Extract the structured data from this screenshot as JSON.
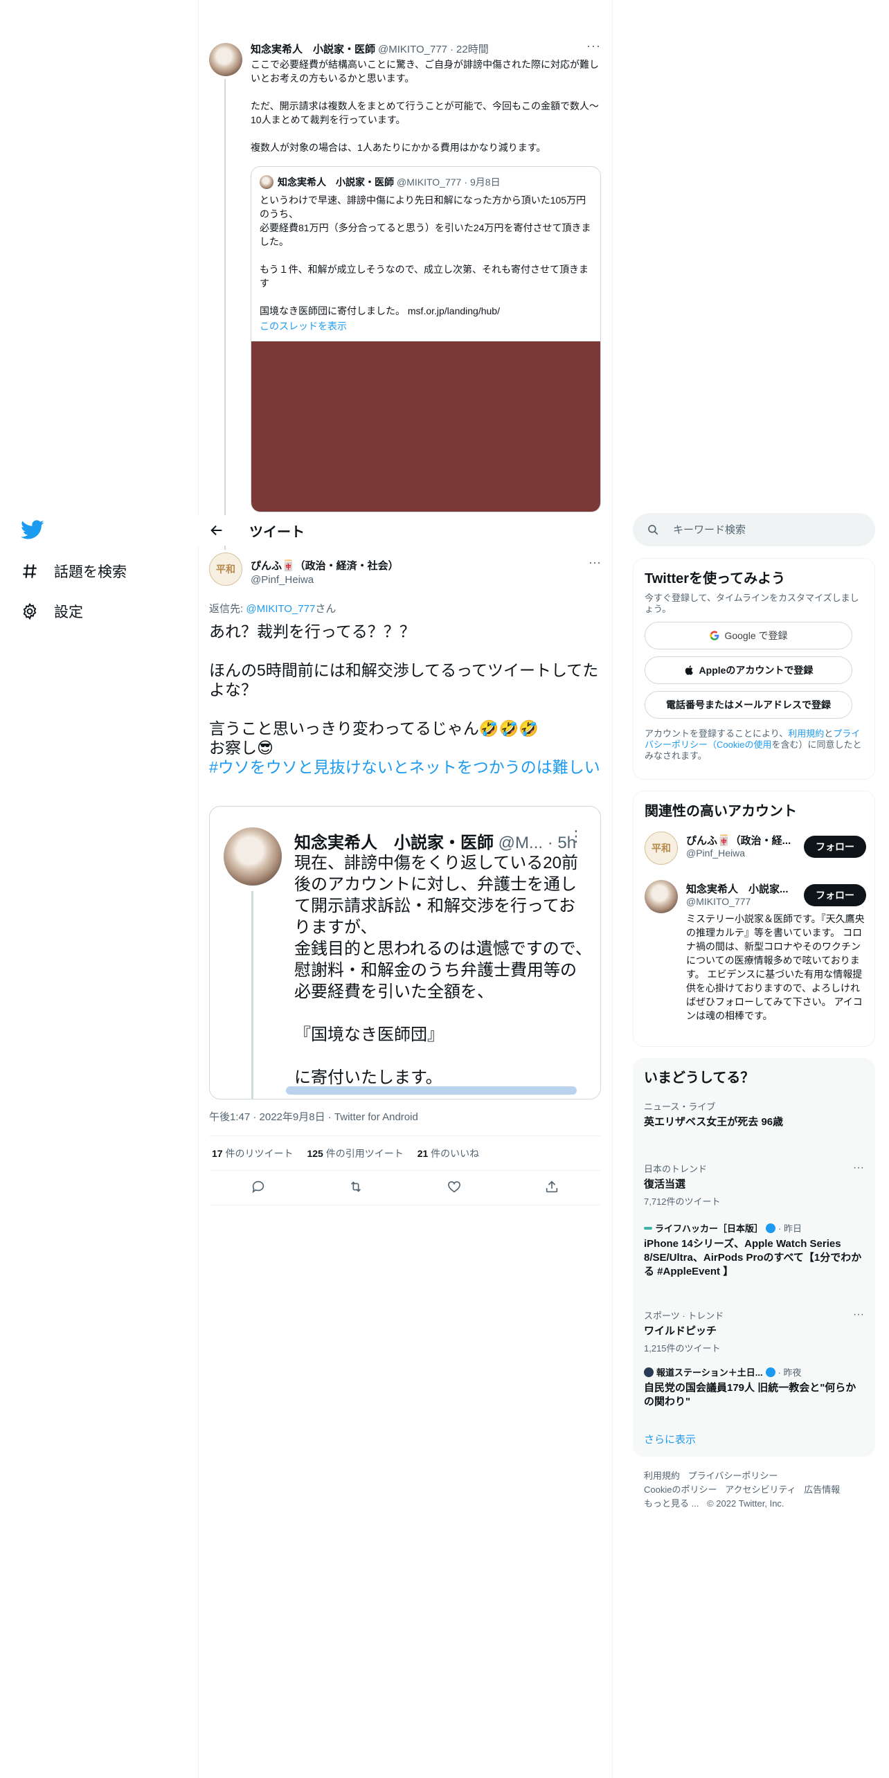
{
  "nav": {
    "logo": "twitter-bird-icon",
    "items": [
      {
        "label": "話題を検索",
        "icon": "hashtag-icon"
      },
      {
        "label": "設定",
        "icon": "gear-icon"
      }
    ]
  },
  "parent_tweet": {
    "name": "知念実希人　小説家・医師",
    "handle": "@MIKITO_777",
    "time": "22時間",
    "text": "ここで必要経費が結構高いことに驚き、ご自身が誹謗中傷された際に対応が難しいとお考えの方もいるかと思います。\n\nただ、開示請求は複数人をまとめて行うことが可能で、今回もこの金額で数人〜10人まとめて裁判を行っています。\n\n複数人が対象の場合は、1人あたりにかかる費用はかなり減ります。",
    "quote": {
      "name": "知念実希人　小説家・医師",
      "handle": "@MIKITO_777",
      "time": "9月8日",
      "text": "というわけで早速、誹謗中傷により先日和解になった方から頂いた105万円のうち、\n必要経費81万円（多分合ってると思う）を引いた24万円を寄付させて頂きました。\n\nもう１件、和解が成立しそうなので、成立し次第、それも寄付させて頂きます\n\n国境なき医師団に寄付しました。 msf.or.jp/landing/hub/",
      "show_thread": "このスレッドを表示"
    }
  },
  "header": {
    "title": "ツイート"
  },
  "tweet": {
    "name": "ぴんふ🀄（政治・経済・社会）",
    "handle": "@Pinf_Heiwa",
    "avatar_text": "平和",
    "reply_prefix": "返信先: ",
    "reply_mention": "@MIKITO_777",
    "reply_suffix": "さん",
    "text": "あれ？裁判を行ってる？？？\n\nほんの5時間前には和解交渉してるってツイートしてたよな？\n\n言うこと思いっきり変わってるじゃん🤣🤣🤣\nお察し😎\n",
    "hashtag": "#ウソをウソと見抜けないとネットをつかうのは難しい",
    "embed": {
      "name": "知念実希人　小説家・医師",
      "handle": "@M...",
      "time": "· 5h",
      "text": "現在、誹謗中傷をくり返している20前後のアカウントに対し、弁護士を通して開示請求訴訟・和解交渉を行っておりますが、\n金銭目的と思われるのは遺憾ですので、慰謝料・和解金のうち弁護士費用等の必要経費を引いた全額を、\n\n『国境なき医師団』\n\nに寄付いたします。"
    },
    "timestamp": "午後1:47 · 2022年9月8日 · Twitter for Android",
    "stats": {
      "retweets": "17",
      "retweets_label": " 件のリツイート",
      "quotes": "125",
      "quotes_label": " 件の引用ツイート",
      "likes": "21",
      "likes_label": " 件のいいね"
    }
  },
  "search": {
    "placeholder": "キーワード検索"
  },
  "join_card": {
    "title": "Twitterを使ってみよう",
    "subtitle": "今すぐ登録して、タイムラインをカスタマイズしましょう。",
    "google_button": "Google で登録",
    "apple_button": "Appleのアカウントで登録",
    "phone_button": "電話番号またはメールアドレスで登録",
    "legal_prefix": "アカウントを登録することにより、",
    "legal_terms": "利用規約",
    "legal_and": "と",
    "legal_privacy": "プライバシーポリシー（Cookieの使用",
    "legal_suffix": "を含む）に同意したとみなされます。"
  },
  "related": {
    "title": "関連性の高いアカウント",
    "accounts": [
      {
        "name": "ぴんふ🀄（政治・経...",
        "handle": "@Pinf_Heiwa",
        "follow": "フォロー"
      },
      {
        "name": "知念実希人　小説家...",
        "handle": "@MIKITO_777",
        "follow": "フォロー",
        "bio": "ミステリー小説家＆医師です。『天久鷹央の推理カルテ』等を書いています。 コロナ禍の間は、新型コロナやそのワクチンについての医療情報多めで呟いております。 エビデンスに基づいた有用な情報提供を心掛けておりますので、よろしければぜひフォローしてみて下さい。 アイコンは魂の相棒です。"
      }
    ]
  },
  "trends": {
    "title": "いまどうしてる？",
    "items": [
      {
        "category": "ニュース・ライブ",
        "name": "英エリザベス女王が死去 96歳"
      },
      {
        "category": "日本のトレンド",
        "name": "復活当選",
        "count": "7,712件のツイート"
      },
      {
        "source": "ライフハッカー［日本版］",
        "time": "· 昨日",
        "name": "iPhone 14シリーズ、Apple Watch Series 8/SE/Ultra、AirPods Proのすべて【1分でわかる #AppleEvent 】"
      },
      {
        "category": "スポーツ · トレンド",
        "name": "ワイルドピッチ",
        "count": "1,215件のツイート"
      },
      {
        "source": "報道ステーション＋土日...",
        "time": "· 昨夜",
        "name": "自民党の国会議員179人 旧統一教会と\"何らかの関わり\""
      }
    ],
    "show_more": "さらに表示"
  },
  "footer": {
    "links": [
      "利用規約",
      "プライバシーポリシー",
      "Cookieのポリシー",
      "アクセシビリティ",
      "広告情報",
      "もっと見る ..."
    ],
    "copyright": "© 2022 Twitter, Inc."
  },
  "colors": {
    "accent": "#1d9bf0",
    "text": "#0f1419",
    "muted": "#536471",
    "quote_image": "#7b3837"
  }
}
